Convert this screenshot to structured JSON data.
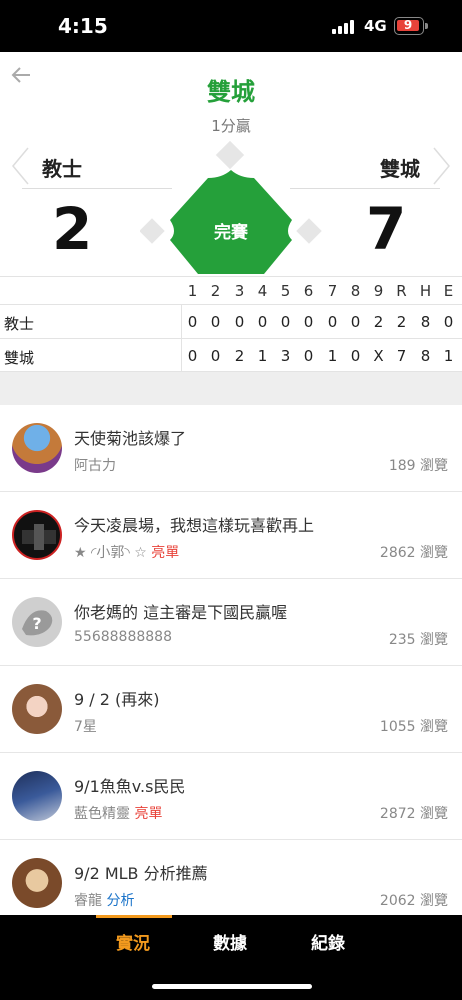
{
  "status_bar": {
    "time": "4:15",
    "network": "4G",
    "battery": "9"
  },
  "header": {
    "title": "雙城",
    "subtitle": "1分贏",
    "away_team": "教士",
    "home_team": "雙城",
    "away_score": "2",
    "home_score": "7",
    "game_status": "完賽"
  },
  "colors": {
    "accent_green": "#25a03a",
    "accent_orange": "#f39a1e",
    "tag_red": "#e8433a",
    "tag_blue": "#1a73c9"
  },
  "scoreboard": {
    "headers": [
      "1",
      "2",
      "3",
      "4",
      "5",
      "6",
      "7",
      "8",
      "9",
      "R",
      "H",
      "E"
    ],
    "rows": [
      {
        "team": "教士",
        "cells": [
          "0",
          "0",
          "0",
          "0",
          "0",
          "0",
          "0",
          "0",
          "2",
          "2",
          "8",
          "0"
        ]
      },
      {
        "team": "雙城",
        "cells": [
          "0",
          "0",
          "2",
          "1",
          "3",
          "0",
          "1",
          "0",
          "X",
          "7",
          "8",
          "1"
        ]
      }
    ]
  },
  "posts": [
    {
      "title": "天使菊池該爆了",
      "author": "阿古力",
      "badge": "",
      "views": "189 瀏覽",
      "avatar_icon": "temple-avatar"
    },
    {
      "title": "今天凌晨場，我想這樣玩喜歡再上",
      "author": "★ ◜小郭◝ ☆",
      "badge": "亮單",
      "views": "2862 瀏覽",
      "avatar_icon": "dark-stage-avatar"
    },
    {
      "title": "你老媽的 這主審是下國民贏喔",
      "author": "55688888888",
      "badge": "",
      "views": "235 瀏覽",
      "avatar_icon": "default-question-avatar"
    },
    {
      "title": "9 / 2 (再來)",
      "author": "7星",
      "badge": "",
      "views": "1055 瀏覽",
      "avatar_icon": "woman-portrait-avatar"
    },
    {
      "title": "9/1魚魚v.s民民",
      "author": "藍色精靈",
      "badge": "亮單",
      "views": "2872 瀏覽",
      "avatar_icon": "poster-avatar"
    },
    {
      "title": "9/2 MLB 分析推薦",
      "author": "睿龍",
      "badge": "分析",
      "views": "2062 瀏覽",
      "avatar_icon": "bearded-man-avatar"
    }
  ],
  "tabs": [
    {
      "label": "實況",
      "active": true
    },
    {
      "label": "數據",
      "active": false
    },
    {
      "label": "紀錄",
      "active": false
    }
  ]
}
